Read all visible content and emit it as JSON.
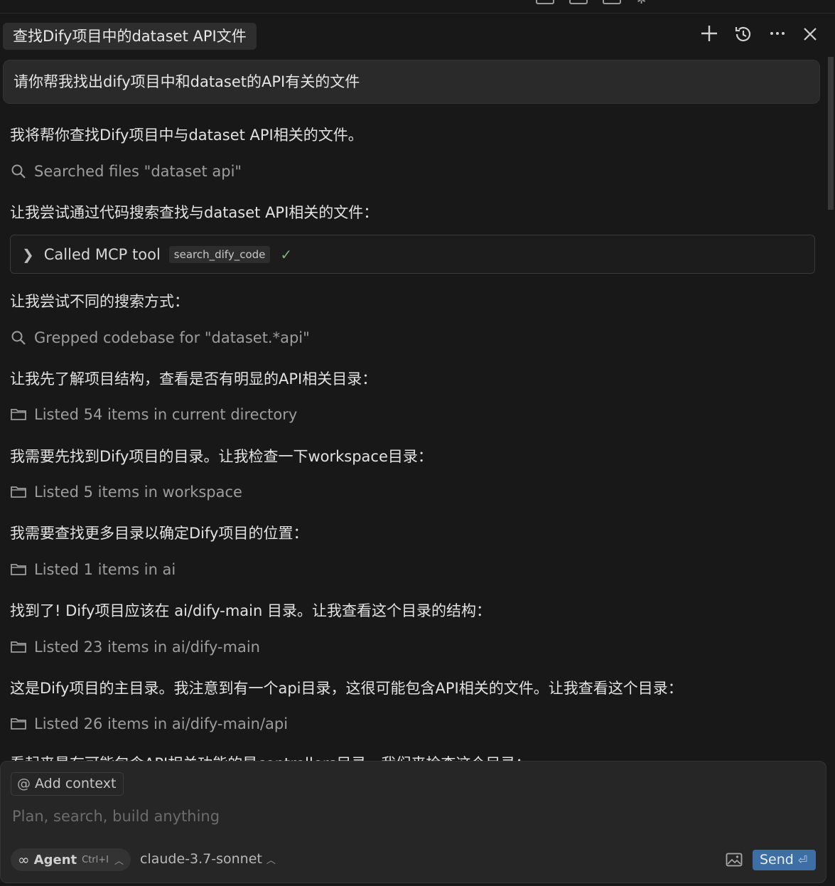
{
  "header": {
    "title": "查找Dify项目中的dataset API文件",
    "icons": {
      "new_chat": "plus-icon",
      "history": "history-icon",
      "more": "more-icon",
      "close": "close-icon"
    }
  },
  "chat": {
    "user_message": "请你帮我找出dify项目中和dataset的API有关的文件",
    "messages": [
      "我将帮你查找Dify项目中与dataset API相关的文件。",
      "让我尝试通过代码搜索查找与dataset API相关的文件：",
      "让我尝试不同的搜索方式：",
      "让我先了解项目结构，查看是否有明显的API相关目录：",
      "我需要先找到Dify项目的目录。让我检查一下workspace目录：",
      "我需要查找更多目录以确定Dify项目的位置：",
      "找到了! Dify项目应该在 ai/dify-main 目录。让我查看这个目录的结构：",
      "这是Dify项目的主目录。我注意到有一个api目录，这很可能包含API相关的文件。让我查看这个目录：",
      "看起来最有可能包含API相关功能的是controllers目录。我们来检查这个目录："
    ],
    "actions": [
      {
        "icon": "search-icon",
        "text": "Searched files \"dataset api\""
      },
      {
        "icon": "search-icon",
        "text": "Grepped codebase for \"dataset.*api\""
      },
      {
        "icon": "folder-icon",
        "text": "Listed 54 items in current directory"
      },
      {
        "icon": "folder-icon",
        "text": "Listed 5 items in workspace"
      },
      {
        "icon": "folder-icon",
        "text": "Listed 1 items in ai"
      },
      {
        "icon": "folder-icon",
        "text": "Listed 23 items in ai/dify-main"
      },
      {
        "icon": "folder-icon",
        "text": "Listed 26 items in ai/dify-main/api"
      }
    ],
    "mcp_call": {
      "label": "Called MCP tool",
      "tool": "search_dify_code",
      "status": "success"
    }
  },
  "composer": {
    "add_context": "Add context",
    "placeholder": "Plan, search, build anything",
    "mode": "Agent",
    "mode_shortcut": "Ctrl+I",
    "model": "claude-3.7-sonnet",
    "send": "Send"
  }
}
